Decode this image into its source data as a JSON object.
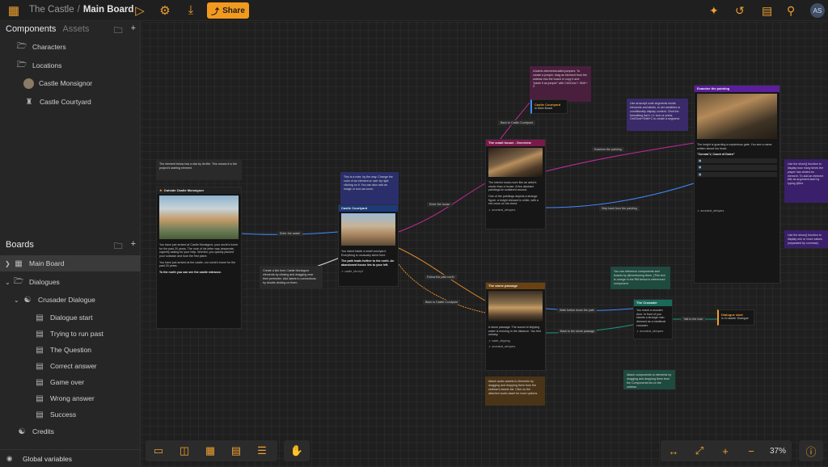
{
  "breadcrumb": {
    "project": "The Castle",
    "separator": "/",
    "board": "Main Board"
  },
  "toolbar": {
    "share_label": "Share",
    "user_initials": "AS"
  },
  "components_panel": {
    "tab_active": "Components",
    "tab_inactive": "Assets",
    "items": [
      {
        "label": "Characters",
        "icon": "folder-icon"
      },
      {
        "label": "Locations",
        "icon": "folder-icon"
      },
      {
        "label": "Castle Monsignor",
        "icon": "avatar-thumb"
      },
      {
        "label": "Castle Courtyard",
        "icon": "castle-icon"
      }
    ]
  },
  "boards_panel": {
    "title": "Boards",
    "items": [
      {
        "label": "Main Board",
        "icon": "board-icon"
      },
      {
        "label": "Dialogues",
        "icon": "folder-icon"
      },
      {
        "label": "Crusader Dialogue",
        "icon": "dialogue-icon"
      },
      {
        "label": "Dialogue start",
        "icon": "page-icon"
      },
      {
        "label": "Trying to run past",
        "icon": "page-icon"
      },
      {
        "label": "The Question",
        "icon": "page-icon"
      },
      {
        "label": "Correct answer",
        "icon": "page-icon"
      },
      {
        "label": "Game over",
        "icon": "page-icon"
      },
      {
        "label": "Wrong answer",
        "icon": "page-icon"
      },
      {
        "label": "Success",
        "icon": "page-icon"
      },
      {
        "label": "Credits",
        "icon": "dialogue-icon"
      }
    ],
    "global_variables": "Global variables"
  },
  "canvas": {
    "zoom": "37%",
    "notes": {
      "starting_element": "The element below has a star by its title. This means it is the project's starting element.",
      "note_hint": "This is a note, by the way. Change the color of an element or user by right clicking on it. You can also add an image or icon as cover.",
      "jumper_hint": "Underlo elements/called jumpers. To create a jumper, drag an element from the sidebar into the board or copy it and \"paste it as jumper\" with Ctrl/Cmd + Shift + V",
      "script_hint": "Use arcscript code segments inside elements and labels, to set variables or conditionally display content. Click the formatting bar's </> icon or press Ctrl/Cmd+Shift+C to create a segment.",
      "component_hint": "You can reference components and boards by @mentioning them. (This text is orange in the RM below is referenced component.",
      "attach_hint": "Attach components to elements by dragging and dropping them from the Components list on the sidebar.",
      "audio_hint": "Attach audio assets to elements by dragging and dropping them from the sidebar's Assets list. Click on the attached audio asset for more options.",
      "show_hint": "Use the show() function to display how many times the player has visited an element. To add an element title as argument start by typing @the.",
      "visit_hint": "Use the show() function to display one or more values (separated by commas).",
      "mention_hint": "Create a link from Castle Monsignor elements by clicking and dragging near their perimeter. Add labels to connections by double clicking on them."
    },
    "nodes": {
      "outside_title": "Outside Castle Monsignor",
      "outside_body": "You have just arrived at Castle Monsignor, your uncle's home for the past 20 years. The note of his letter was desperate, urgently asking for your help. Worried, you quickly packed your suitcase and took the first plane.",
      "outside_body2": "You have just arrived at the castle, our uncle's home for the past 20 years.",
      "outside_bold": "To the north you can see the castle entrance.",
      "courtyard_title": "Castle Courtyard",
      "courtyard_body": "You stand inside a small courtyard. Everything is unusually silent here.",
      "courtyard_bold": "The path leads further to the north. An abandoned house lies to your left.",
      "courtyard_audio": "castle_sfx.mp3",
      "jumper_title": "Castle Courtyard",
      "jumper_sub": "in Main Board",
      "house_title": "The small house - Overview",
      "house_body": "The interior looks more like an artist's studio than a house. A few abstract paintings lie scattered around.",
      "house_body2": "One of the paintings depicts a strange figure: a knight dressed in white, with a red cross on his chest.",
      "house_audio": "ancestral_whispers",
      "painting_title": "Examine the painting",
      "painting_body": "The knight is guarding a mysterious gate. You see a name written above his head:",
      "painting_quote": "\"Conrad V, Count of Dalen\"",
      "painting_audio": "ancestral_whispers",
      "stone_title": "The stone passage",
      "stone_body": "A stone passage. The sound of dripping water is echoing in the distance. You feel uneasy.",
      "stone_audio": "water_dripping",
      "stone_audio2": "ancestral_whispers",
      "crusader_title": "The Crusader",
      "crusader_body": "You reach a wooden door. In front of you stands a strange man dressed as a medieval crusader.",
      "crusader_audio": "ancestral_whispers",
      "dialogue_jump_title": "Dialogue start",
      "dialogue_jump_sub": "in Crusader Dialogue"
    },
    "wire_labels": {
      "enter_castle": "Enter the castle",
      "enter_house": "Enter the house",
      "follow_path": "Follow the path north",
      "back_courtyard": "Back to Castle Courtyard",
      "back_courtyard2": "Back to Castle Courtyard",
      "step_back": "Step back from the painting",
      "examine": "Examine the painting",
      "walk_further": "Walk further down the path",
      "back_passage": "Back to the stone passage",
      "talk": "Talk to the man"
    }
  }
}
